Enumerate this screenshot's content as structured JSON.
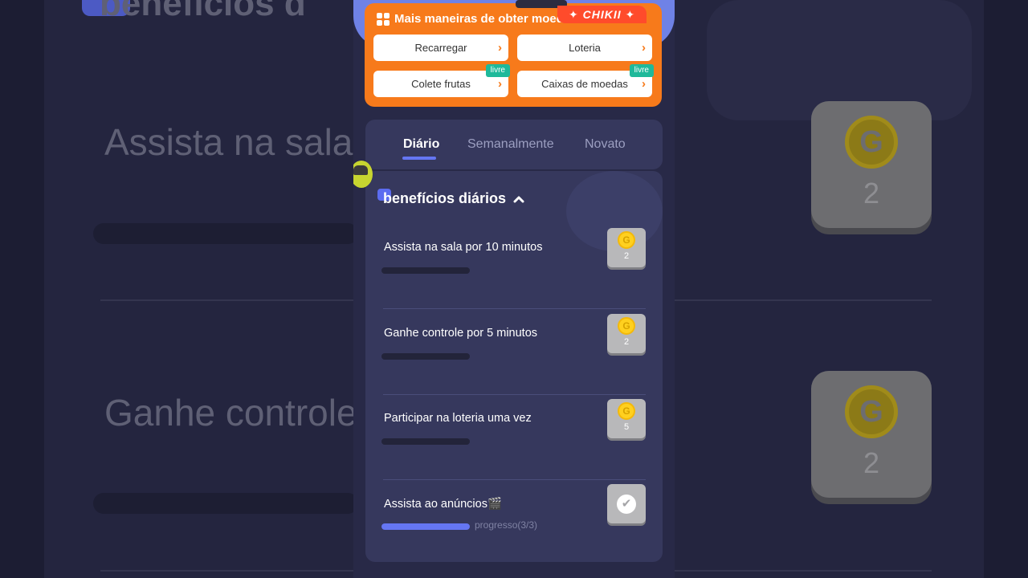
{
  "background": {
    "task1_text": "Assista na sala",
    "task2_text": "Ganhe controle",
    "section_text": "benefícios d",
    "reward1_value": "2",
    "reward2_value": "2",
    "coin_letter": "G"
  },
  "promo": {
    "title": "Mais maneiras de obter moeda",
    "brand": "✦ CHIKII ✦",
    "buttons": [
      {
        "label": "Recarregar",
        "tag": ""
      },
      {
        "label": "Loteria",
        "tag": ""
      },
      {
        "label": "Colete frutas",
        "tag": "livre"
      },
      {
        "label": "Caixas de moedas",
        "tag": "livre"
      }
    ],
    "chevron": "›"
  },
  "tabs": [
    {
      "label": "Diário",
      "active": true
    },
    {
      "label": "Semanalmente",
      "active": false
    },
    {
      "label": "Novato",
      "active": false
    }
  ],
  "section": {
    "title": "benefícios diários"
  },
  "tasks": [
    {
      "title": "Assista na sala por 10 minutos",
      "coin": "G",
      "reward": "2",
      "progress": 0,
      "completed": false
    },
    {
      "title": "Ganhe controle por 5 minutos",
      "coin": "G",
      "reward": "2",
      "progress": 0,
      "completed": false
    },
    {
      "title": "Participar na loteria uma vez",
      "coin": "G",
      "reward": "5",
      "progress": 0,
      "completed": false
    },
    {
      "title": "Assista ao anúncios🎬",
      "progress_text": "progresso(3/3)",
      "progress": 1.0,
      "completed": true,
      "check": "✔"
    }
  ],
  "colors": {
    "accent": "#6576f2",
    "promo_orange": "#f77a1b",
    "free_tag": "#1fb99a",
    "panel": "#36385d",
    "coin": "#ffd01f"
  }
}
